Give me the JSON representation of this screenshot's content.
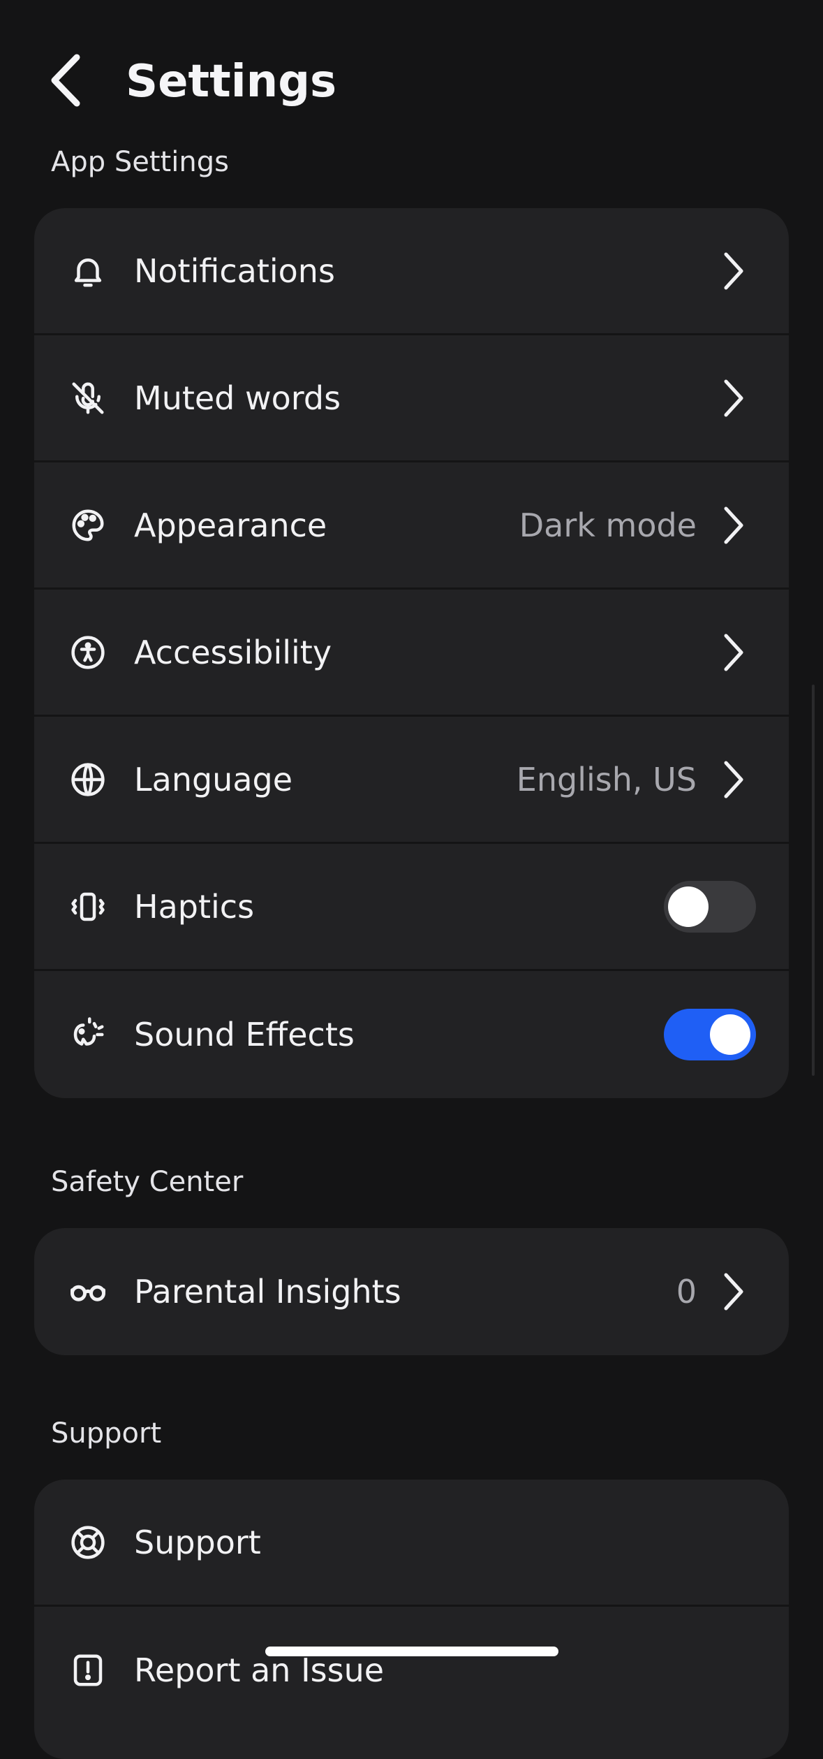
{
  "header": {
    "title": "Settings"
  },
  "sections": {
    "app_settings": {
      "label": "App Settings",
      "items": [
        {
          "label": "Notifications",
          "icon": "bell-icon"
        },
        {
          "label": "Muted words",
          "icon": "mic-off-icon"
        },
        {
          "label": "Appearance",
          "value": "Dark mode",
          "icon": "palette-icon"
        },
        {
          "label": "Accessibility",
          "icon": "accessibility-icon"
        },
        {
          "label": "Language",
          "value": "English, US",
          "icon": "globe-icon"
        },
        {
          "label": "Haptics",
          "icon": "vibrate-icon",
          "toggle": false
        },
        {
          "label": "Sound Effects",
          "icon": "sound-effects-icon",
          "toggle": true
        }
      ]
    },
    "safety_center": {
      "label": "Safety Center",
      "items": [
        {
          "label": "Parental Insights",
          "value": "0",
          "icon": "glasses-icon"
        }
      ]
    },
    "support": {
      "label": "Support",
      "items": [
        {
          "label": "Support",
          "icon": "lifebuoy-icon"
        },
        {
          "label": "Report an Issue",
          "icon": "report-icon"
        }
      ]
    }
  },
  "colors": {
    "background": "#141415",
    "card": "#222224",
    "accent": "#1f5ff5",
    "secondary_text": "#a8a8ae"
  }
}
